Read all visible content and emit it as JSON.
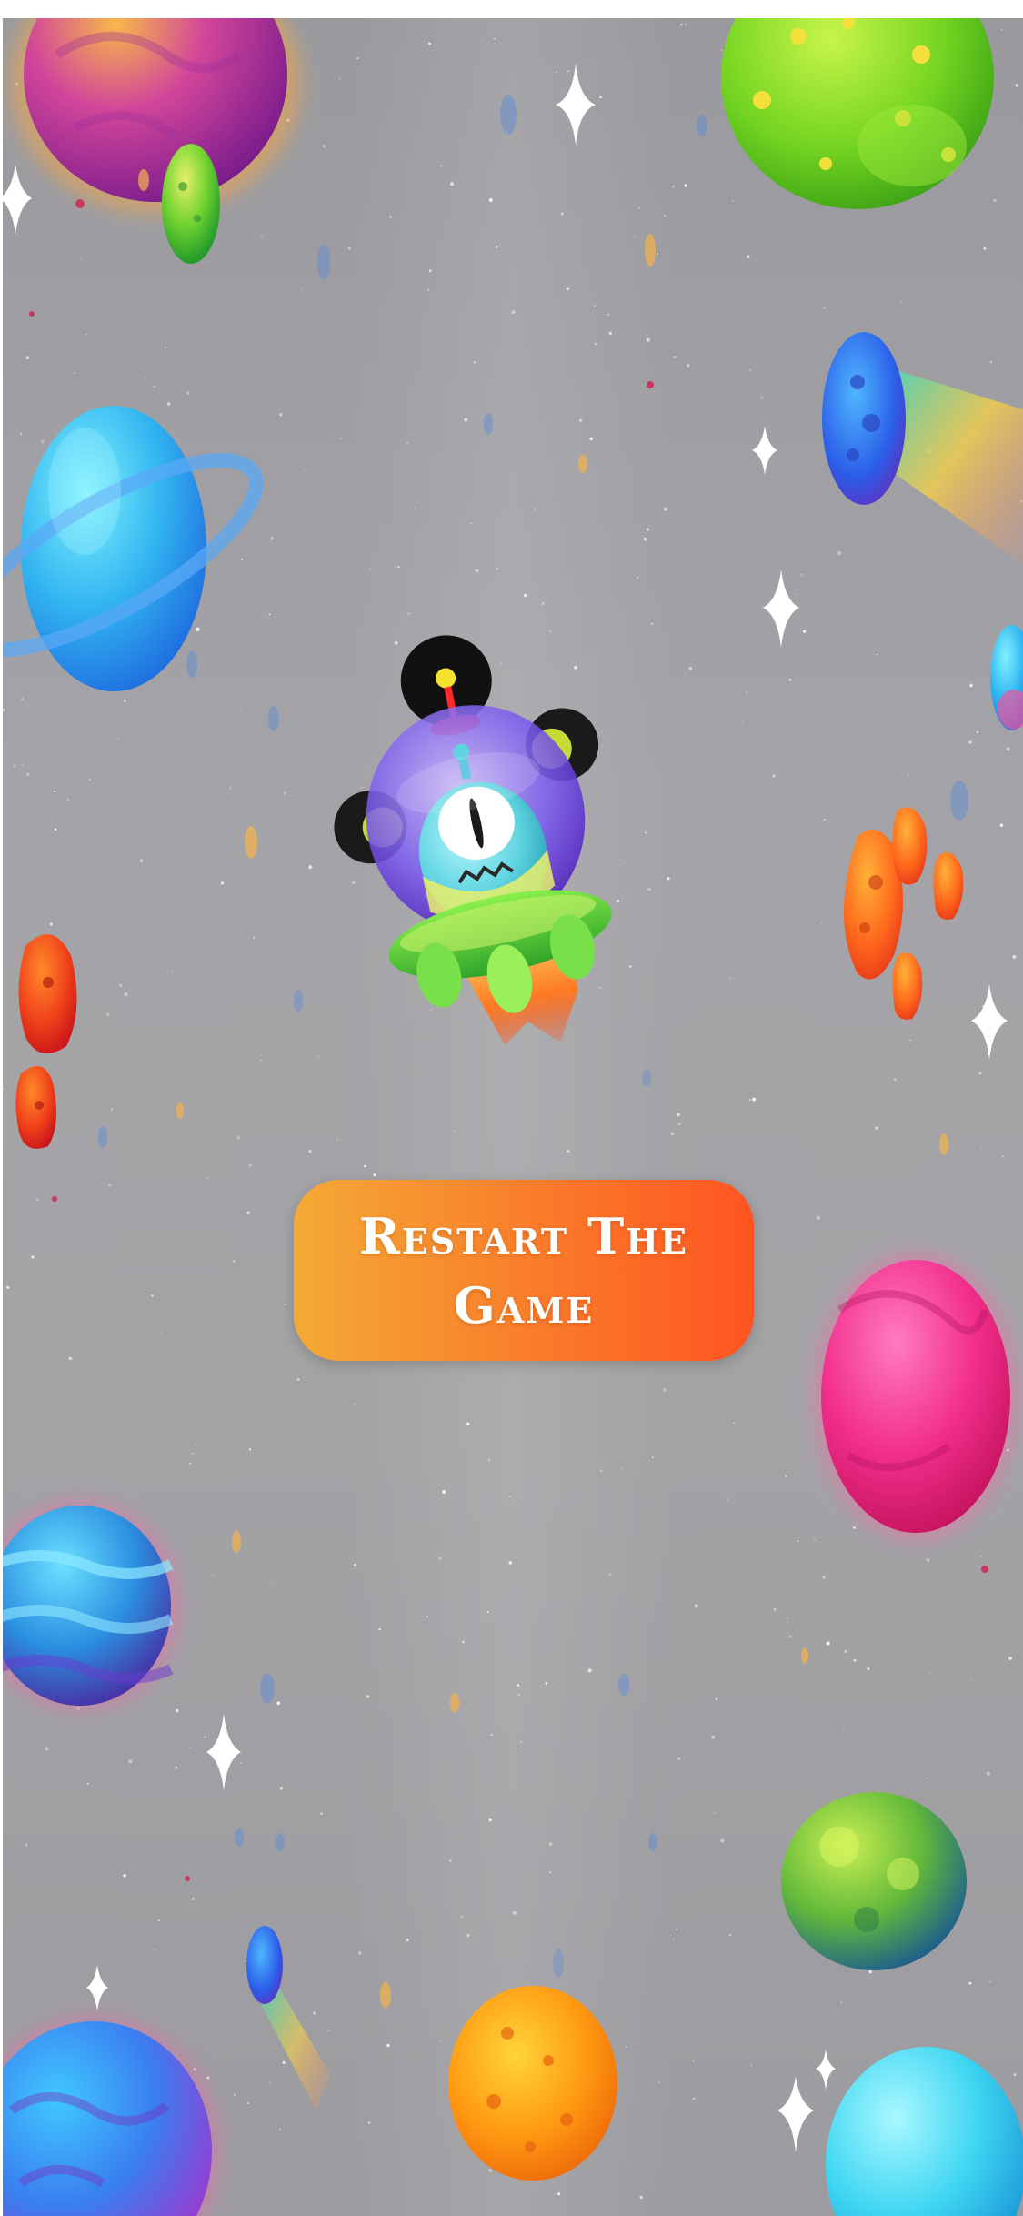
{
  "screen": {
    "background_color": "#a2a2a6",
    "top_strip_color": "#ffffff"
  },
  "restart_button": {
    "label": "Restart The Game",
    "gradient_start": "#f3aa36",
    "gradient_end": "#ff5521",
    "text_color": "#ffffff"
  },
  "player": {
    "icon": "alien-ufo-rocket-icon"
  },
  "decorations": {
    "planets": [
      "orange-purple-planet",
      "green-spotted-planet",
      "small-green-planet",
      "blue-ringed-planet",
      "blue-comet-planet",
      "pink-planet",
      "blue-striped-planet",
      "green-blue-planet",
      "orange-spotted-planet",
      "blue-purple-planet",
      "cyan-planet"
    ],
    "asteroids": [
      "orange-asteroid-cluster",
      "red-asteroid"
    ],
    "sparkles": [
      "sparkle-icon"
    ]
  }
}
